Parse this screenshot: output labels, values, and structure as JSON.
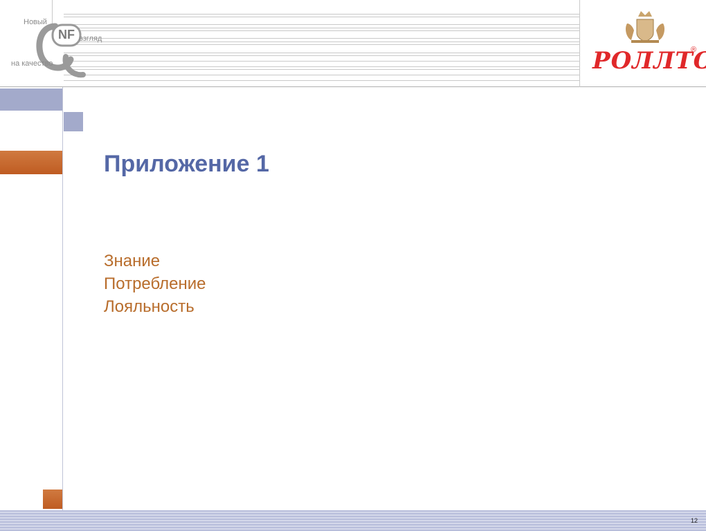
{
  "header": {
    "nf_logo": {
      "line1": "Новый",
      "line2": "взгляд",
      "line3": "на качество",
      "mark": "NF"
    },
    "brand_logo": {
      "name": "РОЛЛТОН",
      "registered": "®",
      "color": "#e0282a"
    }
  },
  "slide": {
    "title": "Приложение 1",
    "items": [
      "Знание",
      "Потребление",
      "Лояльность"
    ]
  },
  "footer": {
    "page_number": "12"
  },
  "colors": {
    "title": "#5568a6",
    "items": "#b86d2c",
    "blue_block": "#a3aacb",
    "orange_block": "#c8672e"
  }
}
